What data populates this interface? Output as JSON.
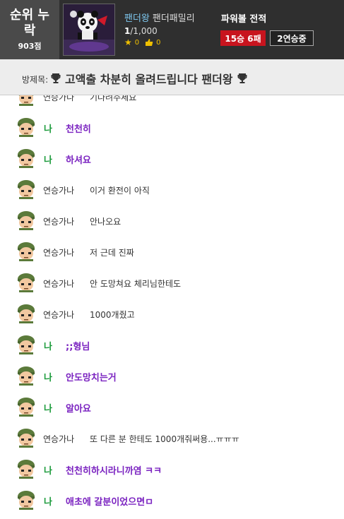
{
  "header": {
    "rank_label": "순위 누락",
    "rank_value": "903점",
    "nickname": "팬더왕",
    "guild": "팬더패밀리",
    "level_current": "1",
    "level_rest": "/1,000",
    "stars": "0",
    "likes": "0",
    "powerball_title": "파워볼 전적",
    "record": "15승 6패",
    "streak": "2연승중"
  },
  "room": {
    "label": "방제목:",
    "title": "고액출 차분히 올려드립니다 팬더왕"
  },
  "messages": [
    {
      "sender": "연승가나",
      "text": "기다려주세요",
      "me": false
    },
    {
      "sender": "나",
      "text": "천천히",
      "me": true
    },
    {
      "sender": "나",
      "text": "하셔요",
      "me": true
    },
    {
      "sender": "연승가나",
      "text": "이거 환전이 아직",
      "me": false
    },
    {
      "sender": "연승가나",
      "text": "안나오요",
      "me": false
    },
    {
      "sender": "연승가나",
      "text": "저 근데 진짜",
      "me": false
    },
    {
      "sender": "연승가나",
      "text": "안 도망쳐요 체리님한테도",
      "me": false
    },
    {
      "sender": "연승가나",
      "text": "1000개줬고",
      "me": false
    },
    {
      "sender": "나",
      "text": ";;형님",
      "me": true
    },
    {
      "sender": "나",
      "text": "안도망치는거",
      "me": true
    },
    {
      "sender": "나",
      "text": "알아요",
      "me": true
    },
    {
      "sender": "연승가나",
      "text": "또 다른 분 한테도 1000개줘써용...ㅠㅠㅠ",
      "me": false
    },
    {
      "sender": "나",
      "text": "천천히하시라니까염 ㅋㅋ",
      "me": true
    },
    {
      "sender": "나",
      "text": "애초에 갈분이었으면ㅁ",
      "me": true
    }
  ],
  "icons": {
    "trophy": "trophy-icon",
    "avatar": "soldier-face-icon",
    "star": "star-icon",
    "like": "thumbs-up-icon"
  },
  "colors": {
    "header_bg": "#2f2f2f",
    "record_badge": "#c8141e",
    "my_sender": "#1a9a3a",
    "my_text": "#7a22c0"
  }
}
